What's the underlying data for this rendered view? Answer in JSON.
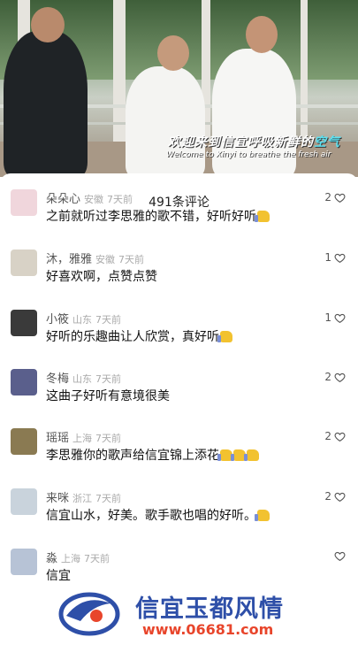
{
  "video": {
    "caption_cn_main": "欢迎来到信宜呼吸新鲜的",
    "caption_cn_highlight": "空气",
    "caption_en": "Welcome to Xinyi to breathe the fresh air"
  },
  "comments_panel": {
    "title": "491条评论",
    "collapse_icon": "chevron-down-icon",
    "like_icon": "heart-outline-icon"
  },
  "comments": [
    {
      "user": "朵朵心",
      "location": "安徽",
      "time": "7天前",
      "text": "之前就听过李思雅的歌不错，好听好听",
      "thumbs": 1,
      "likes": "2",
      "avatar_color": "#f0d6dc"
    },
    {
      "user": "沐，雅雅",
      "location": "安徽",
      "time": "7天前",
      "text": "好喜欢啊，点赞点赞",
      "thumbs": 0,
      "likes": "1",
      "avatar_color": "#d8d2c6"
    },
    {
      "user": "小筱",
      "location": "山东",
      "time": "7天前",
      "text": "好听的乐趣曲让人欣赏，真好听",
      "thumbs": 1,
      "likes": "1",
      "avatar_color": "#3a3a3a"
    },
    {
      "user": "冬梅",
      "location": "山东",
      "time": "7天前",
      "text": "这曲子好听有意境很美",
      "thumbs": 0,
      "likes": "2",
      "avatar_color": "#5a5f8c"
    },
    {
      "user": "瑶瑶",
      "location": "上海",
      "time": "7天前",
      "text": "李思雅你的歌声给信宜锦上添花",
      "thumbs": 3,
      "likes": "2",
      "avatar_color": "#8a7a52"
    },
    {
      "user": "来咪",
      "location": "浙江",
      "time": "7天前",
      "text": "信宜山水，好美。歌手歌也唱的好听。",
      "thumbs": 1,
      "likes": "2",
      "avatar_color": "#c9d3dc"
    },
    {
      "user": "淼",
      "location": "上海",
      "time": "7天前",
      "text": "信宜",
      "thumbs": 0,
      "likes": "",
      "avatar_color": "#b7c3d6"
    }
  ],
  "watermark": {
    "title": "信宜玉都风情",
    "url": "www.06681.com"
  },
  "colors": {
    "accent_cyan": "#5ee0f0",
    "thumb_yellow": "#f2c230",
    "watermark_blue": "#2e4fa8",
    "watermark_red": "#e8452b"
  }
}
